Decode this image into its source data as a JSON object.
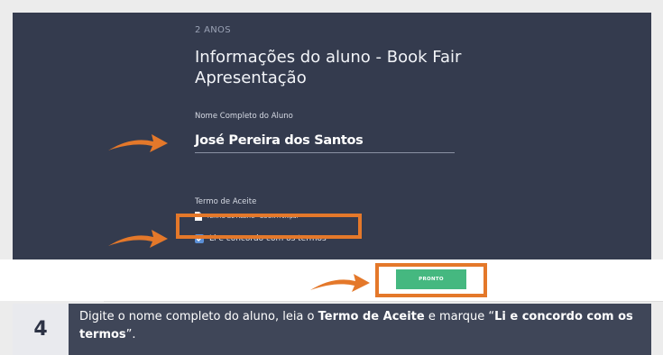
{
  "form": {
    "grade": "2 ANOS",
    "title": "Informações do aluno - Book Fair Apresentação",
    "name_label": "Nome Completo do Aluno",
    "name_value": "José Pereira dos Santos",
    "terms_label": "Termo de Aceite",
    "terms_file": "TERMO DE ACEITE - BOOK FAIR.pdf",
    "agree_label": "Li e concordo com os termos",
    "agree_checked": true,
    "submit_label": "PRONTO"
  },
  "instruction": {
    "step_number": "4",
    "text_1": "Digite o nome completo do aluno, leia o ",
    "bold_1": "Termo de Aceite",
    "text_2": " e marque “",
    "bold_2": "Li e concordo com os termos",
    "text_3": "”."
  },
  "colors": {
    "panel_bg": "#343b4e",
    "highlight": "#e4782a",
    "button": "#45b880",
    "checkbox": "#5b8fd6"
  },
  "icons": [
    "arrow-right-icon",
    "file-icon",
    "checkbox-checked-icon"
  ]
}
